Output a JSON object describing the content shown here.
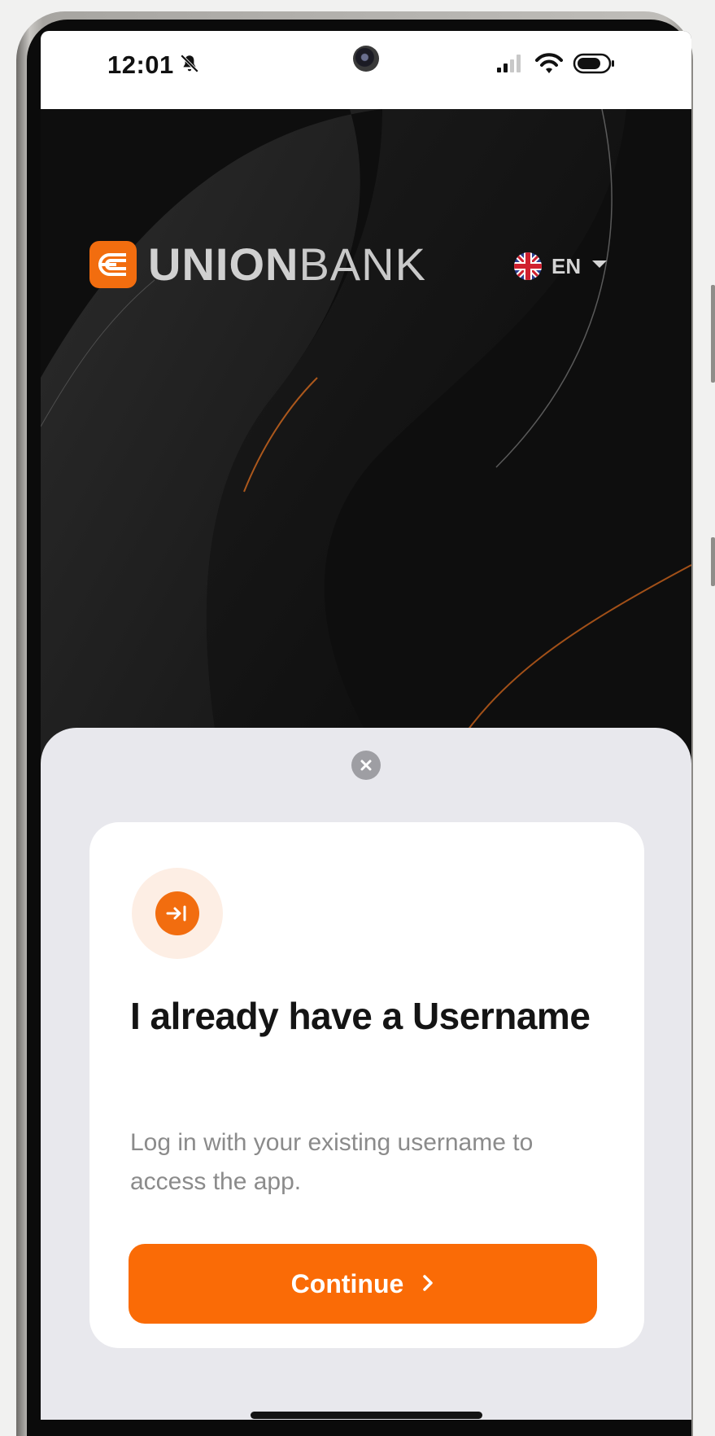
{
  "status_bar": {
    "time": "12:01",
    "icons": [
      "bell-slash-icon",
      "signal-icon",
      "wifi-icon",
      "battery-icon"
    ]
  },
  "header": {
    "brand_bold": "UNION",
    "brand_light": "BANK",
    "logo_icon": "unionbank-logo-icon",
    "language_code": "EN",
    "language_flag": "uk-flag-icon"
  },
  "sheet": {
    "close_icon": "close-icon",
    "card": {
      "icon": "login-arrow-icon",
      "title": "I already have a Username",
      "description": "Log in with your existing username to access the app.",
      "button_label": "Continue",
      "button_icon": "chevron-right-icon"
    }
  },
  "colors": {
    "accent": "#fa6b06",
    "sheet_bg": "#e8e8ed",
    "hero_bg": "#0e0e0e"
  }
}
